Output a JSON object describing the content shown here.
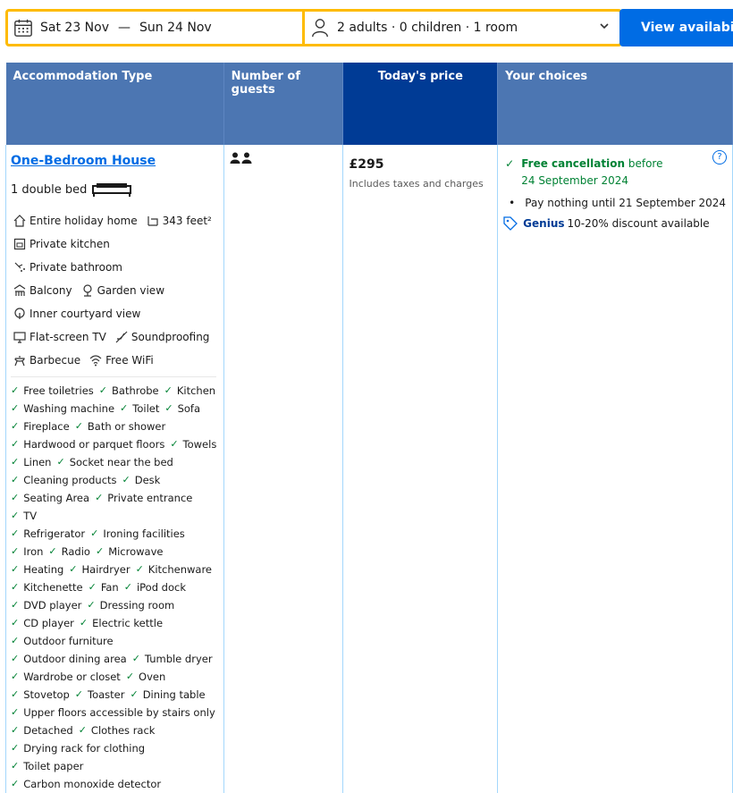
{
  "search": {
    "check_in": "Sat 23 Nov",
    "dash": "—",
    "check_out": "Sun 24 Nov",
    "guests": "2 adults · 0 children · 1 room",
    "view_button": "View availability"
  },
  "table": {
    "headers": {
      "type": "Accommodation Type",
      "guests": "Number of guests",
      "price": "Today's price",
      "choices": "Your choices"
    }
  },
  "room": {
    "title": "One-Bedroom House",
    "bed": "1 double bed",
    "facilities": [
      [
        "Entire holiday home",
        "343 feet²"
      ],
      [
        "Private kitchen",
        "Private bathroom"
      ],
      [
        "Balcony",
        "Garden view"
      ],
      [
        "Inner courtyard view"
      ],
      [
        "Flat-screen TV",
        "Soundproofing"
      ],
      [
        "Barbecue",
        "Free WiFi"
      ]
    ],
    "amenities": [
      [
        "Free toiletries",
        "Bathrobe",
        "Kitchen"
      ],
      [
        "Washing machine",
        "Toilet",
        "Sofa"
      ],
      [
        "Fireplace",
        "Bath or shower"
      ],
      [
        "Hardwood or parquet floors",
        "Towels"
      ],
      [
        "Linen",
        "Socket near the bed"
      ],
      [
        "Cleaning products",
        "Desk"
      ],
      [
        "Seating Area",
        "Private entrance",
        "TV"
      ],
      [
        "Refrigerator",
        "Ironing facilities"
      ],
      [
        "Iron",
        "Radio",
        "Microwave"
      ],
      [
        "Heating",
        "Hairdryer",
        "Kitchenware"
      ],
      [
        "Kitchenette",
        "Fan",
        "iPod dock"
      ],
      [
        "DVD player",
        "Dressing room"
      ],
      [
        "CD player",
        "Electric kettle"
      ],
      [
        "Outdoor furniture"
      ],
      [
        "Outdoor dining area",
        "Tumble dryer"
      ],
      [
        "Wardrobe or closet",
        "Oven"
      ],
      [
        "Stovetop",
        "Toaster",
        "Dining table"
      ],
      [
        "Upper floors accessible by stairs only"
      ],
      [
        "Detached",
        "Clothes rack"
      ],
      [
        "Drying rack for clothing",
        "Toilet paper"
      ],
      [
        "Carbon monoxide detector"
      ]
    ],
    "price": "£295",
    "price_note": "Includes taxes and charges",
    "choices": {
      "free_cancel": "Free cancellation",
      "before": "before 24 September 2024",
      "pay_nothing": "Pay nothing until 21 September 2024",
      "genius": "Genius",
      "genius_text": "10-20% discount available"
    }
  }
}
